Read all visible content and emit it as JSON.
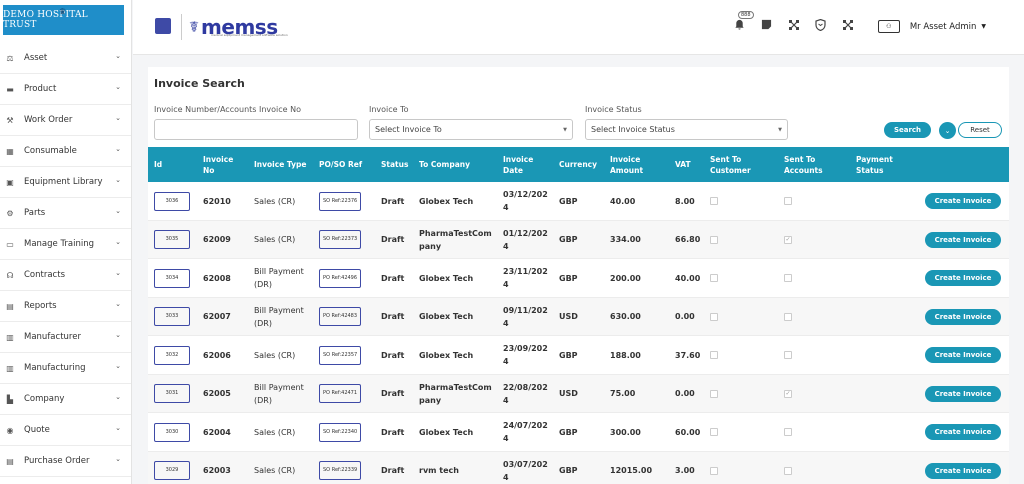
{
  "brand": {
    "name": "DEMO HOSPITAL TRUST"
  },
  "sidebar": {
    "items": [
      {
        "label": "Asset",
        "icon": "asset-icon"
      },
      {
        "label": "Product",
        "icon": "product-icon"
      },
      {
        "label": "Work Order",
        "icon": "work-order-icon"
      },
      {
        "label": "Consumable",
        "icon": "consumable-icon"
      },
      {
        "label": "Equipment Library",
        "icon": "equipment-library-icon"
      },
      {
        "label": "Parts",
        "icon": "parts-icon"
      },
      {
        "label": "Manage Training",
        "icon": "training-icon"
      },
      {
        "label": "Contracts",
        "icon": "contracts-icon"
      },
      {
        "label": "Reports",
        "icon": "reports-icon"
      },
      {
        "label": "Manufacturer",
        "icon": "manufacturer-icon"
      },
      {
        "label": "Manufacturing",
        "icon": "manufacturing-icon"
      },
      {
        "label": "Company",
        "icon": "company-icon"
      },
      {
        "label": "Quote",
        "icon": "quote-icon"
      },
      {
        "label": "Purchase Order",
        "icon": "purchase-order-icon"
      }
    ]
  },
  "topbar": {
    "logo_text": "memss",
    "logo_tagline": "medical equipment management software solution",
    "notification_count": "888",
    "user_name": "Mr Asset Admin"
  },
  "search": {
    "title": "Invoice Search",
    "invoice_no_label": "Invoice Number/Accounts Invoice No",
    "invoice_to_label": "Invoice To",
    "invoice_to_placeholder": "Select Invoice To",
    "status_label": "Invoice Status",
    "status_placeholder": "Select Invoice Status",
    "search_button": "Search",
    "reset_button": "Reset"
  },
  "table": {
    "headers": {
      "id": "Id",
      "invoice_no": "Invoice No",
      "invoice_type": "Invoice Type",
      "po_so_ref": "PO/SO Ref",
      "status": "Status",
      "to_company": "To Company",
      "invoice_date": "Invoice Date",
      "currency": "Currency",
      "invoice_amount": "Invoice Amount",
      "vat": "VAT",
      "sent_to_customer": "Sent To Customer",
      "sent_to_accounts": "Sent To Accounts",
      "payment_status": "Payment Status"
    },
    "action_label": "Create Invoice",
    "rows": [
      {
        "id": "3036",
        "invoice_no": "62010",
        "type": "Sales (CR)",
        "ref": "SO Ref:22376",
        "status": "Draft",
        "company": "Globex Tech",
        "date": "03/12/2024",
        "currency": "GBP",
        "amount": "40.00",
        "vat": "8.00",
        "sent_accounts": false
      },
      {
        "id": "3035",
        "invoice_no": "62009",
        "type": "Sales (CR)",
        "ref": "SO Ref:22373",
        "status": "Draft",
        "company": "PharmaTestCompany",
        "date": "01/12/2024",
        "currency": "GBP",
        "amount": "334.00",
        "vat": "66.80",
        "sent_accounts": true
      },
      {
        "id": "3034",
        "invoice_no": "62008",
        "type": "Bill Payment (DR)",
        "ref": "PO Ref:42496",
        "status": "Draft",
        "company": "Globex Tech",
        "date": "23/11/2024",
        "currency": "GBP",
        "amount": "200.00",
        "vat": "40.00",
        "sent_accounts": false
      },
      {
        "id": "3033",
        "invoice_no": "62007",
        "type": "Bill Payment (DR)",
        "ref": "PO Ref:42483",
        "status": "Draft",
        "company": "Globex Tech",
        "date": "09/11/2024",
        "currency": "USD",
        "amount": "630.00",
        "vat": "0.00",
        "sent_accounts": false
      },
      {
        "id": "3032",
        "invoice_no": "62006",
        "type": "Sales (CR)",
        "ref": "SO Ref:22357",
        "status": "Draft",
        "company": "Globex Tech",
        "date": "23/09/2024",
        "currency": "GBP",
        "amount": "188.00",
        "vat": "37.60",
        "sent_accounts": false
      },
      {
        "id": "3031",
        "invoice_no": "62005",
        "type": "Bill Payment (DR)",
        "ref": "PO Ref:42471",
        "status": "Draft",
        "company": "PharmaTestCompany",
        "date": "22/08/2024",
        "currency": "USD",
        "amount": "75.00",
        "vat": "0.00",
        "sent_accounts": true
      },
      {
        "id": "3030",
        "invoice_no": "62004",
        "type": "Sales (CR)",
        "ref": "SO Ref:22340",
        "status": "Draft",
        "company": "Globex Tech",
        "date": "24/07/2024",
        "currency": "GBP",
        "amount": "300.00",
        "vat": "60.00",
        "sent_accounts": false
      },
      {
        "id": "3029",
        "invoice_no": "62003",
        "type": "Sales (CR)",
        "ref": "SO Ref:22339",
        "status": "Draft",
        "company": "rvm tech",
        "date": "03/07/2024",
        "currency": "GBP",
        "amount": "12015.00",
        "vat": "3.00",
        "sent_accounts": false
      }
    ]
  }
}
